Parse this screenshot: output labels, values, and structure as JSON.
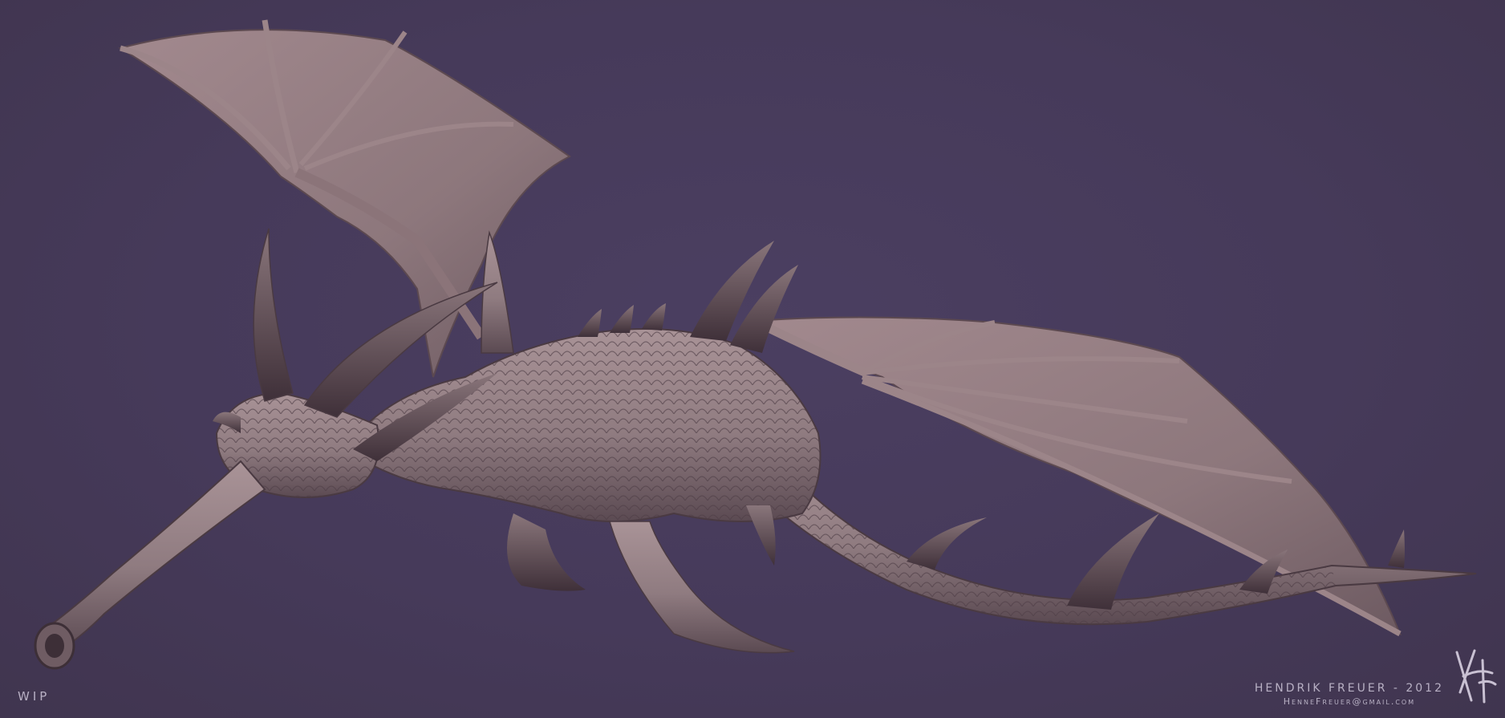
{
  "artwork": {
    "subject": "dragon-sculpt",
    "colors": {
      "background": "#463a5a",
      "clay": "#8f7b80",
      "clay_light": "#a99397",
      "clay_dark": "#4a3a42",
      "text": "#b8b0c4"
    }
  },
  "labels": {
    "status": "WIP",
    "author_line": "HENDRIK FREUER - 2012",
    "email": "HenneFreuer@gmail.com"
  },
  "signature": {
    "type": "handwritten-monogram",
    "text": "HF"
  }
}
